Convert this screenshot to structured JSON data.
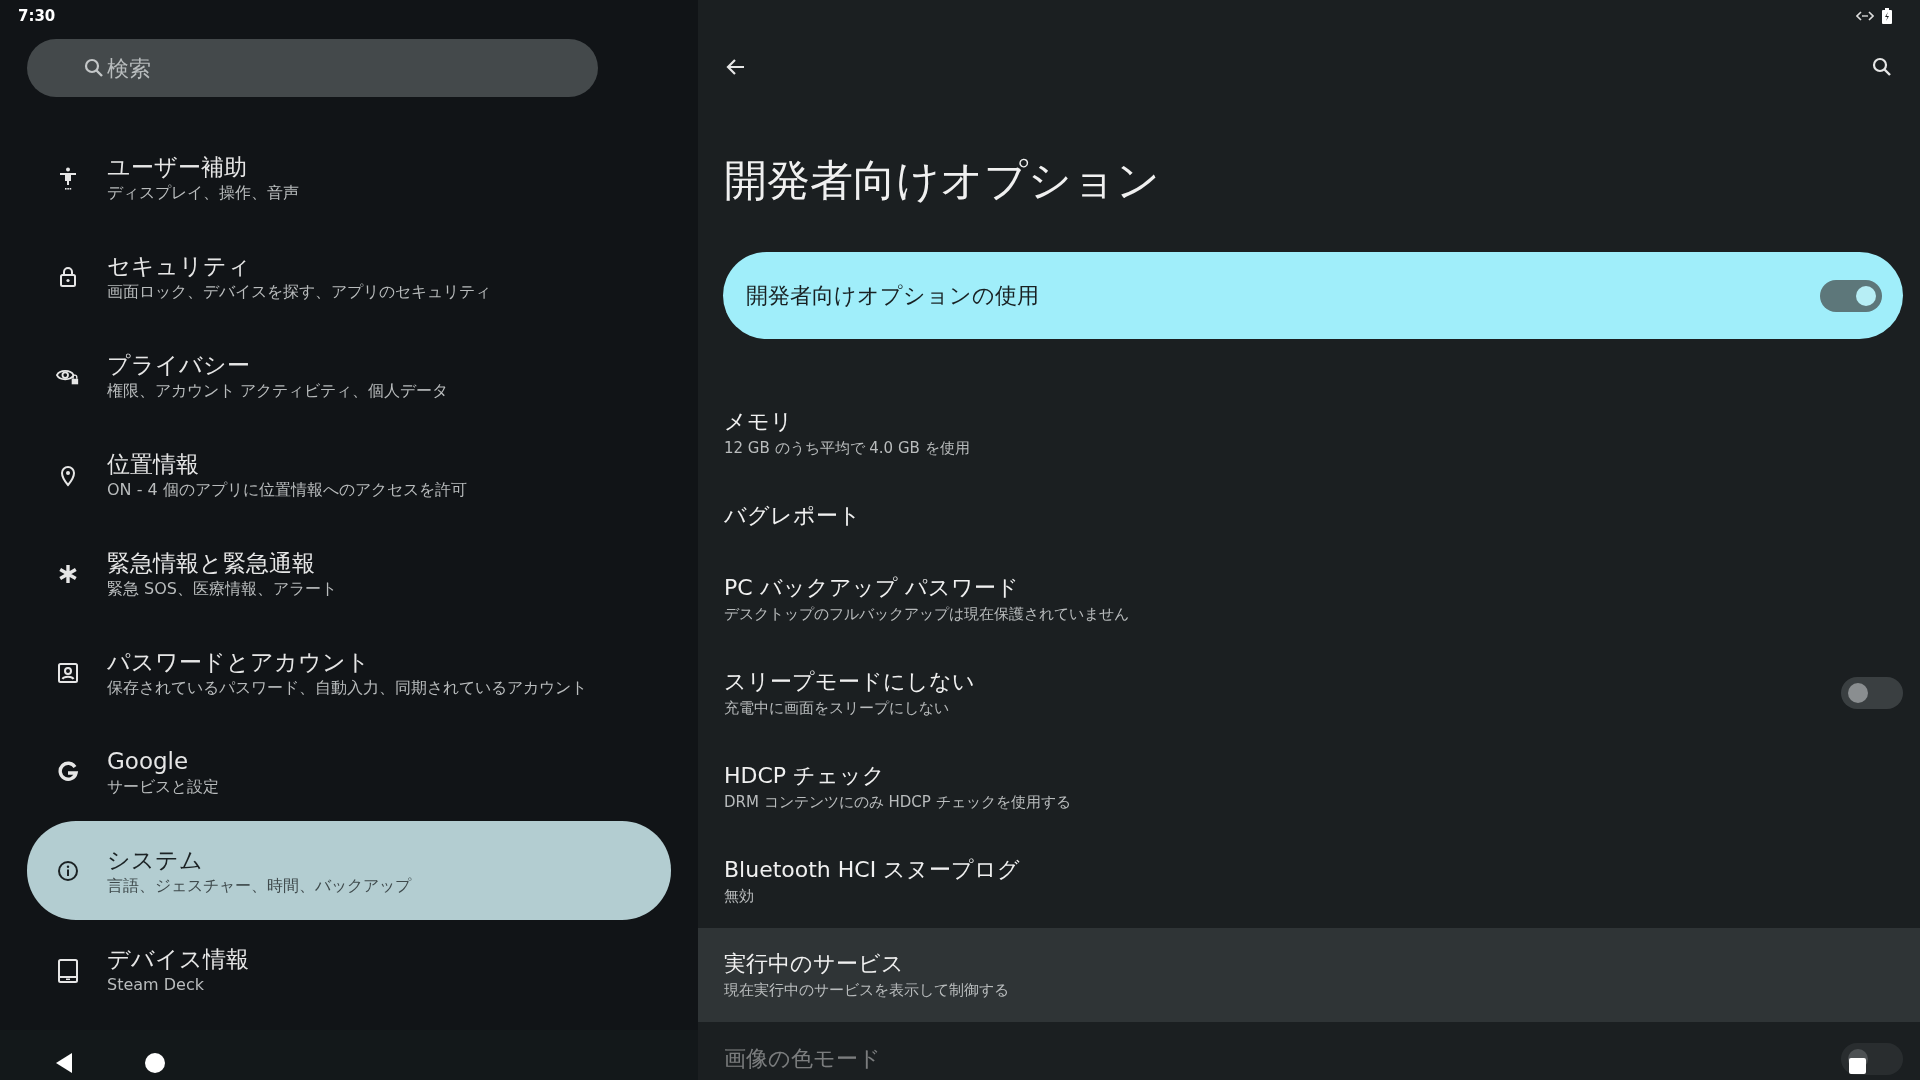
{
  "status_bar": {
    "time": "7:30"
  },
  "sidebar": {
    "search": {
      "placeholder": "検索"
    },
    "items": [
      {
        "kind": "accessibility",
        "title": "ユーザー補助",
        "subtitle": "ディスプレイ、操作、音声",
        "selected": false
      },
      {
        "kind": "lock",
        "title": "セキュリティ",
        "subtitle": "画面ロック、デバイスを探す、アプリのセキュリティ",
        "selected": false
      },
      {
        "kind": "privacy",
        "title": "プライバシー",
        "subtitle": "権限、アカウント アクティビティ、個人データ",
        "selected": false
      },
      {
        "kind": "location",
        "title": "位置情報",
        "subtitle": "ON - 4 個のアプリに位置情報へのアクセスを許可",
        "selected": false
      },
      {
        "kind": "asterisk",
        "title": "緊急情報と緊急通報",
        "subtitle": "緊急 SOS、医療情報、アラート",
        "selected": false
      },
      {
        "kind": "account",
        "title": "パスワードとアカウント",
        "subtitle": "保存されているパスワード、自動入力、同期されているアカウント",
        "selected": false
      },
      {
        "kind": "g",
        "title": "Google",
        "subtitle": "サービスと設定",
        "selected": false
      },
      {
        "kind": "info",
        "title": "システム",
        "subtitle": "言語、ジェスチャー、時間、バックアップ",
        "selected": true
      },
      {
        "kind": "tablet",
        "title": "デバイス情報",
        "subtitle": "Steam Deck",
        "selected": false
      }
    ]
  },
  "page": {
    "title": "開発者向けオプション",
    "main_switch": {
      "label": "開発者向けオプションの使用",
      "on": true
    },
    "rows": [
      {
        "kind": "plain",
        "title": "メモリ",
        "subtitle": "12 GB のうち平均で 4.0 GB を使用",
        "highlighted": false,
        "disabled": false
      },
      {
        "kind": "plain",
        "title": "バグレポート",
        "highlighted": false,
        "disabled": false
      },
      {
        "kind": "plain",
        "title": "PC バックアップ パスワード",
        "subtitle": "デスクトップのフルバックアップは現在保護されていません",
        "highlighted": false,
        "disabled": false
      },
      {
        "kind": "switch",
        "title": "スリープモードにしない",
        "subtitle": "充電中に画面をスリープにしない",
        "on": false,
        "highlighted": false,
        "disabled": false
      },
      {
        "kind": "plain",
        "title": "HDCP チェック",
        "subtitle": "DRM コンテンツにのみ HDCP チェックを使用する",
        "highlighted": false,
        "disabled": false
      },
      {
        "kind": "plain",
        "title": "Bluetooth HCI スヌープログ",
        "subtitle": "無効",
        "highlighted": false,
        "disabled": false
      },
      {
        "kind": "plain",
        "title": "実行中のサービス",
        "subtitle": "現在実行中のサービスを表示して制御する",
        "highlighted": true,
        "disabled": false
      },
      {
        "kind": "switch",
        "title": "画像の色モード",
        "on": false,
        "highlighted": false,
        "disabled": true
      }
    ]
  }
}
